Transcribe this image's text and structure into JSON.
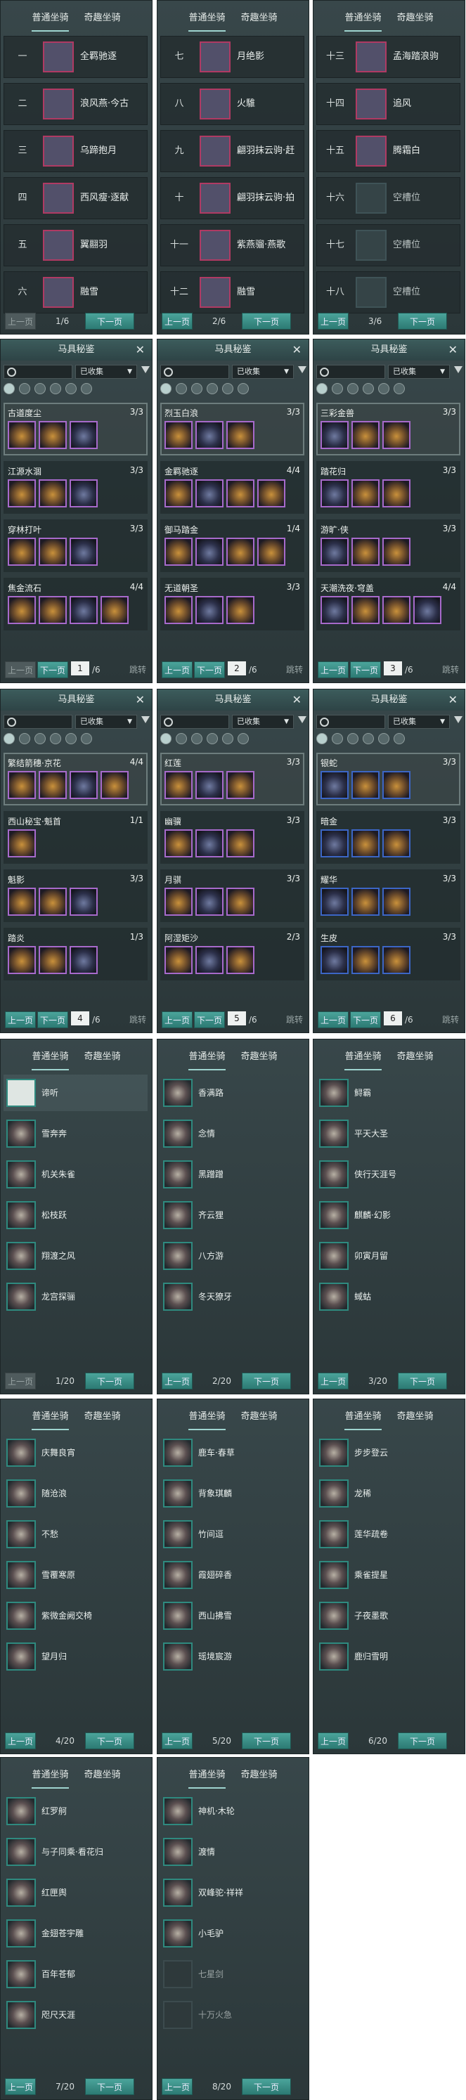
{
  "tabs": {
    "normal": "普通坐骑",
    "fun": "奇趣坐骑"
  },
  "pager": {
    "prev": "上一页",
    "next": "下一页",
    "jump": "跳转"
  },
  "mount_pages": [
    {
      "page": "1/6",
      "rows": [
        {
          "idx": "一",
          "name": "全羁驰逐"
        },
        {
          "idx": "二",
          "name": "浪风燕·今古"
        },
        {
          "idx": "三",
          "name": "乌蹄抱月"
        },
        {
          "idx": "四",
          "name": "西风瘦·逐献"
        },
        {
          "idx": "五",
          "name": "翼翮羽"
        },
        {
          "idx": "六",
          "name": "融雪"
        }
      ]
    },
    {
      "page": "2/6",
      "rows": [
        {
          "idx": "七",
          "name": "月绝影"
        },
        {
          "idx": "八",
          "name": "火騅"
        },
        {
          "idx": "九",
          "name": "翩羽抹云驹·赶"
        },
        {
          "idx": "十",
          "name": "翩羽抹云驹·拍"
        },
        {
          "idx": "十一",
          "name": "紫燕骝·燕歌"
        },
        {
          "idx": "十二",
          "name": "融雪"
        }
      ]
    },
    {
      "page": "3/6",
      "rows": [
        {
          "idx": "十三",
          "name": "孟海踏浪驹"
        },
        {
          "idx": "十四",
          "name": "追风"
        },
        {
          "idx": "十五",
          "name": "腾霜白"
        },
        {
          "idx": "十六",
          "name": "空槽位"
        },
        {
          "idx": "十七",
          "name": "空槽位"
        },
        {
          "idx": "十八",
          "name": "空槽位"
        }
      ]
    }
  ],
  "album": {
    "title": "马具秘鉴",
    "filter": "已收集",
    "pages": [
      {
        "page": "1",
        "total": "/6",
        "sets": [
          {
            "name": "古道度尘",
            "count": "3/3",
            "n": 3
          },
          {
            "name": "江源水涸",
            "count": "3/3",
            "n": 3
          },
          {
            "name": "穿林打叶",
            "count": "3/3",
            "n": 3
          },
          {
            "name": "焦金流石",
            "count": "4/4",
            "n": 4
          }
        ]
      },
      {
        "page": "2",
        "total": "/6",
        "sets": [
          {
            "name": "烈玉白浪",
            "count": "3/3",
            "n": 3
          },
          {
            "name": "金羁驰逐",
            "count": "4/4",
            "n": 4
          },
          {
            "name": "御马踏金",
            "count": "1/4",
            "n": 4
          },
          {
            "name": "无道朝圣",
            "count": "3/3",
            "n": 3
          }
        ]
      },
      {
        "page": "3",
        "total": "/6",
        "sets": [
          {
            "name": "三彩金兽",
            "count": "3/3",
            "n": 3
          },
          {
            "name": "踏花归",
            "count": "3/3",
            "n": 3
          },
          {
            "name": "游旷·侠",
            "count": "3/3",
            "n": 3
          },
          {
            "name": "天潮洗夜·穹盖",
            "count": "4/4",
            "n": 4
          }
        ]
      },
      {
        "page": "4",
        "total": "/6",
        "sets": [
          {
            "name": "繁结箭穗·京花",
            "count": "4/4",
            "n": 4
          },
          {
            "name": "西山秘宝·魁首",
            "count": "1/1",
            "n": 1
          },
          {
            "name": "魁影",
            "count": "3/3",
            "n": 3
          },
          {
            "name": "踏炎",
            "count": "1/3",
            "n": 3
          }
        ]
      },
      {
        "page": "5",
        "total": "/6",
        "sets": [
          {
            "name": "红莲",
            "count": "3/3",
            "n": 3
          },
          {
            "name": "幽骥",
            "count": "3/3",
            "n": 3
          },
          {
            "name": "月骐",
            "count": "3/3",
            "n": 3
          },
          {
            "name": "阿湿矩沙",
            "count": "2/3",
            "n": 3
          }
        ]
      },
      {
        "page": "6",
        "total": "/6",
        "sets": [
          {
            "name": "银蛇",
            "count": "3/3",
            "n": 3
          },
          {
            "name": "暗金",
            "count": "3/3",
            "n": 3
          },
          {
            "name": "耀华",
            "count": "3/3",
            "n": 3
          },
          {
            "name": "生皮",
            "count": "3/3",
            "n": 3
          }
        ]
      }
    ]
  },
  "fun_pages": [
    {
      "page": "1/20",
      "items": [
        "谛听",
        "雪奔奔",
        "机关朱雀",
        "松枝跃",
        "翔渡之风",
        "龙宫探骊"
      ]
    },
    {
      "page": "2/20",
      "items": [
        "香满路",
        "念情",
        "黑蹭蹭",
        "齐云狸",
        "八方游",
        "冬天獠牙"
      ]
    },
    {
      "page": "3/20",
      "items": [
        "鲟霸",
        "平天大圣",
        "侠行天涯号",
        "麒麟·幻影",
        "卯寅月留",
        "蜮蛄"
      ]
    },
    {
      "page": "4/20",
      "items": [
        "庆舞良宵",
        "随沧浪",
        "不愁",
        "雪覆寒原",
        "紫微金阙交椅",
        "望月归"
      ]
    },
    {
      "page": "5/20",
      "items": [
        "鹿车·春草",
        "背象琪麟",
        "竹间逗",
        "霞翅碎香",
        "西山拂雪",
        "瑶境宸游"
      ]
    },
    {
      "page": "6/20",
      "items": [
        "步步登云",
        "龙稀",
        "莲华疏卷",
        "乘雀提星",
        "子夜墨歌",
        "鹿归雪明"
      ]
    },
    {
      "page": "7/20",
      "items": [
        "红罗舸",
        "与子同乘·看花归",
        "红匣舆",
        "金翅苍宇雕",
        "百年苍郁",
        "咫尺天涯"
      ]
    },
    {
      "page": "8/20",
      "items": [
        "神机·木轮",
        "渡情",
        "双峰驼·祥祥",
        "小毛驴",
        "七星剑",
        "十万火急"
      ]
    }
  ]
}
